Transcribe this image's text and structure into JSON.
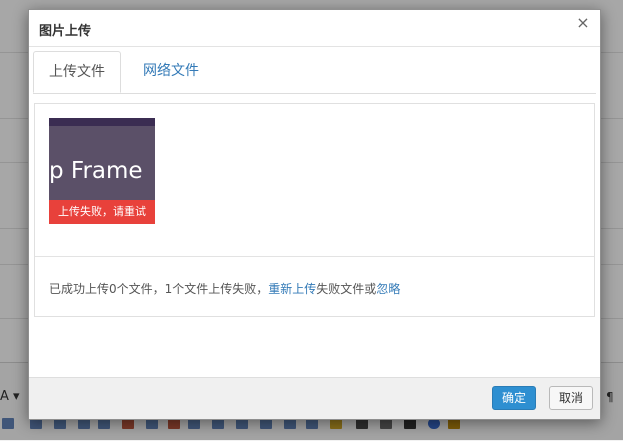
{
  "background": {
    "font_button": "A ▾",
    "paragraph_button": "¶"
  },
  "dialog": {
    "title": "图片上传",
    "close_glyph": "×",
    "tabs": [
      {
        "label": "上传文件",
        "active": true
      },
      {
        "label": "网络文件",
        "active": false
      }
    ],
    "file": {
      "thumbnail_text": "p Frame",
      "error_text": "上传失败，请重试"
    },
    "status": {
      "prefix": "已成功上传0个文件，1个文件上传失败，",
      "retry_link": "重新上传",
      "middle": "失败文件或",
      "ignore_link": "忽略"
    },
    "buttons": {
      "ok": "确定",
      "cancel": "取消"
    }
  },
  "colors": {
    "accent": "#337ab7",
    "primary_button": "#2e8fd1",
    "error": "#e8413b"
  }
}
